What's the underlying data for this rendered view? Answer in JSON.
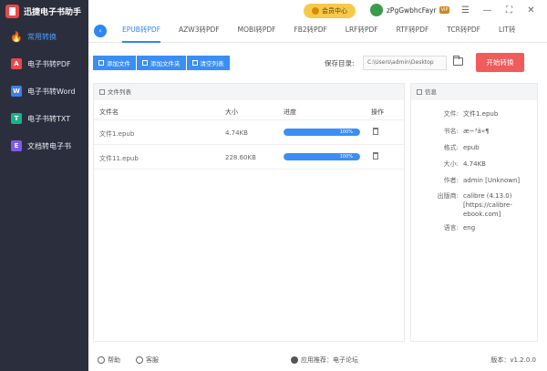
{
  "app": {
    "title": "迅捷电子书助手"
  },
  "sidebar": {
    "items": [
      {
        "label": "常用转换"
      },
      {
        "label": "电子书转PDF"
      },
      {
        "label": "电子书转Word"
      },
      {
        "label": "电子书转TXT"
      },
      {
        "label": "文档转电子书"
      }
    ]
  },
  "header": {
    "member_label": "会员中心",
    "username": "zPgGwbhcFayr",
    "vip_label": "VIP"
  },
  "tabs": [
    "EPUB转PDF",
    "AZW3转PDF",
    "MOBI转PDF",
    "FB2转PDF",
    "LRF转PDF",
    "RTF转PDF",
    "TCR转PDF",
    "LIT转"
  ],
  "toolbar": {
    "add_file": "添加文件",
    "add_folder": "添加文件夹",
    "clear_list": "清空列表",
    "save_label": "保存目录:",
    "save_path": "C:\\Users\\admin\\Desktop",
    "start_label": "开始转换"
  },
  "file_list": {
    "title": "文件列表",
    "columns": {
      "name": "文件名",
      "size": "大小",
      "progress": "进度",
      "action": "操作"
    },
    "rows": [
      {
        "name": "文件1.epub",
        "size": "4.74KB",
        "progress": 1.0,
        "progress_text": "100%"
      },
      {
        "name": "文件11.epub",
        "size": "228.60KB",
        "progress": 1.0,
        "progress_text": "100%"
      }
    ]
  },
  "info": {
    "title": "信息",
    "rows": [
      {
        "key": "文件:",
        "value": "文件1.epub"
      },
      {
        "key": "书名:",
        "value": "æ~³ä»¶"
      },
      {
        "key": "格式:",
        "value": "epub"
      },
      {
        "key": "大小:",
        "value": "4.74KB"
      },
      {
        "key": "作者:",
        "value": "admin [Unknown]"
      },
      {
        "key": "出版商:",
        "value": "calibre (4.13.0) [https://calibre-ebook.com]"
      },
      {
        "key": "语言:",
        "value": "eng"
      }
    ]
  },
  "footer": {
    "help": "帮助",
    "feedback": "客服",
    "app_recommend": "应用推荐：电子论坛",
    "version": "版本：v1.2.0.0"
  },
  "colors": {
    "accent": "#2f86f6",
    "sidebar_bg": "#2b2f3d",
    "start_button": "#f05b5b"
  }
}
